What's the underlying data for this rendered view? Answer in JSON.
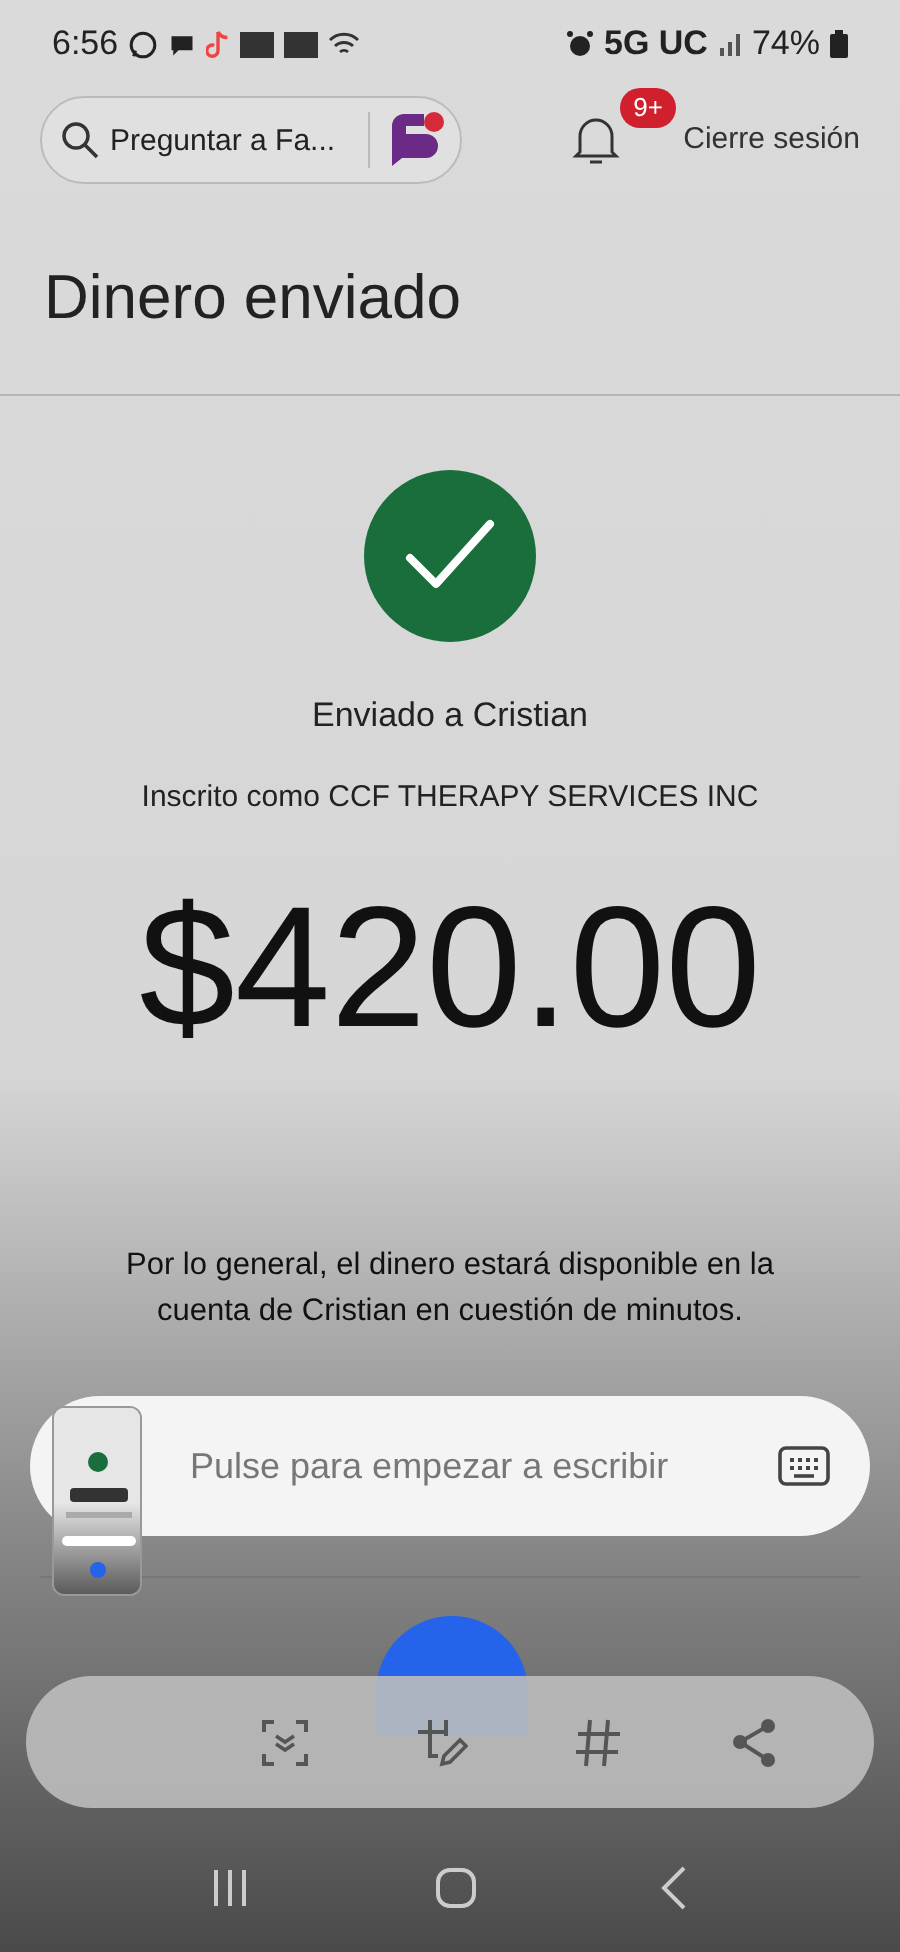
{
  "status_bar": {
    "time": "6:56",
    "network": "5G UC",
    "battery": "74%"
  },
  "header": {
    "search": {
      "placeholder": "Preguntar a Fa..."
    },
    "notifications": {
      "badge": "9+"
    },
    "logout": "Cierre sesión"
  },
  "title": "Dinero enviado",
  "confirmation": {
    "recipient": "Enviado a Cristian",
    "enrolled_as": "Inscrito como CCF THERAPY SERVICES INC",
    "amount": "$420.00",
    "note": "Por lo general, el dinero estará disponible en la cuenta de Cristian en cuestión de minutos."
  },
  "writing_bar": {
    "placeholder": "Pulse para empezar a escribir"
  },
  "screenshot_toolbar": {
    "actions": [
      {
        "kind": "scan"
      },
      {
        "kind": "edit"
      },
      {
        "kind": "tag"
      },
      {
        "kind": "share"
      }
    ]
  }
}
